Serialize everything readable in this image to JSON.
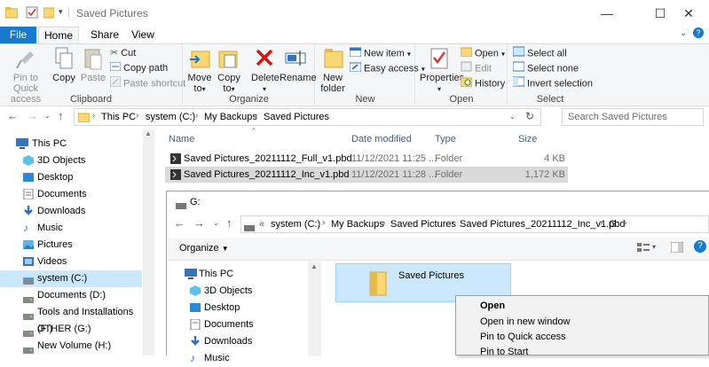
{
  "window": {
    "title": "Saved Pictures",
    "controls": {
      "minimize": "—",
      "maximize": "☐",
      "close": "✕"
    }
  },
  "ribbon_tabs": [
    "File",
    "Home",
    "Share",
    "View"
  ],
  "ribbon": {
    "clipboard": {
      "label": "Clipboard",
      "pin": [
        "Pin to Quick",
        "access"
      ],
      "copy": "Copy",
      "paste": "Paste",
      "cut": "Cut",
      "copy_path": "Copy path",
      "paste_shortcut": "Paste shortcut"
    },
    "organize": {
      "label": "Organize",
      "move_to": [
        "Move",
        "to"
      ],
      "copy_to": [
        "Copy",
        "to"
      ],
      "delete": "Delete",
      "rename": "Rename"
    },
    "new": {
      "label": "New",
      "new_folder": [
        "New",
        "folder"
      ],
      "new_item": "New item",
      "easy_access": "Easy access"
    },
    "open": {
      "label": "Open",
      "properties": "Properties",
      "open": "Open",
      "edit": "Edit",
      "history": "History"
    },
    "select": {
      "label": "Select",
      "select_all": "Select all",
      "select_none": "Select none",
      "invert": "Invert selection"
    }
  },
  "address": {
    "crumbs": [
      "This PC",
      "system (C:)",
      "My Backups",
      "Saved Pictures"
    ],
    "search_placeholder": "Search Saved Pictures"
  },
  "nav_pane": [
    {
      "label": "This PC",
      "icon": "pc-icon"
    },
    {
      "label": "3D Objects",
      "icon": "3d-objects-icon"
    },
    {
      "label": "Desktop",
      "icon": "desktop-icon"
    },
    {
      "label": "Documents",
      "icon": "documents-icon"
    },
    {
      "label": "Downloads",
      "icon": "downloads-icon"
    },
    {
      "label": "Music",
      "icon": "music-icon"
    },
    {
      "label": "Pictures",
      "icon": "pictures-icon"
    },
    {
      "label": "Videos",
      "icon": "videos-icon"
    },
    {
      "label": "system (C:)",
      "icon": "drive-icon",
      "selected": true
    },
    {
      "label": "Documents (D:)",
      "icon": "drive-icon"
    },
    {
      "label": "Tools and Installations (F:)",
      "icon": "drive-icon"
    },
    {
      "label": "OTHER (G:)",
      "icon": "drive-icon"
    },
    {
      "label": "New Volume (H:)",
      "icon": "drive-icon"
    }
  ],
  "columns": {
    "name": "Name",
    "date": "Date modified",
    "type": "Type",
    "size": "Size"
  },
  "files": [
    {
      "name": "Saved Pictures_20211112_Full_v1.pbd",
      "date": "11/12/2021 11:25 ...",
      "type": "Folder",
      "size": "4 KB"
    },
    {
      "name": "Saved Pictures_20211112_Inc_v1.pbd",
      "date": "11/12/2021 11:28 ...",
      "type": "Folder",
      "size": "1,172 KB",
      "selected": true
    }
  ],
  "overlay": {
    "title": "G:",
    "crumbs_prefix": "«",
    "crumbs": [
      "system (C:)",
      "My Backups",
      "Saved Pictures",
      "Saved Pictures_20211112_Inc_v1.pbd",
      "G:"
    ],
    "organize": "Organize",
    "nav": [
      {
        "label": "This PC",
        "icon": "pc-icon"
      },
      {
        "label": "3D Objects",
        "icon": "3d-objects-icon"
      },
      {
        "label": "Desktop",
        "icon": "desktop-icon"
      },
      {
        "label": "Documents",
        "icon": "documents-icon"
      },
      {
        "label": "Downloads",
        "icon": "downloads-icon"
      },
      {
        "label": "Music",
        "icon": "music-icon"
      }
    ],
    "folder": "Saved Pictures"
  },
  "context_menu": [
    "Open",
    "Open in new window",
    "Pin to Quick access",
    "Pin to Start"
  ],
  "colors": {
    "accent": "#1979ca",
    "selection": "#cce8ff",
    "folder": "#f8d775"
  }
}
